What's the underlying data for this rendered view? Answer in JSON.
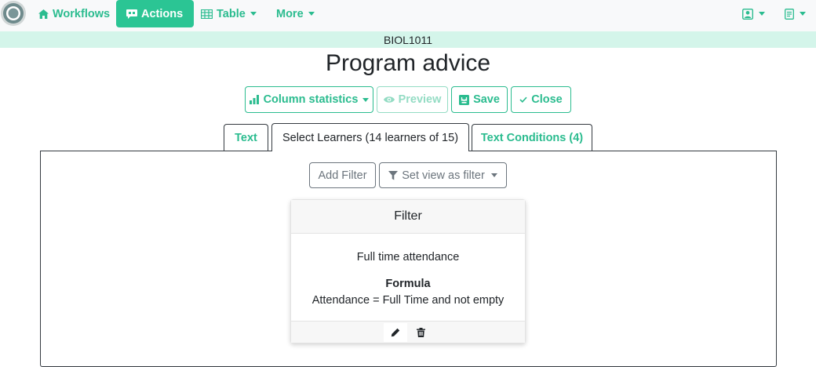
{
  "navbar": {
    "workflows_label": "Workflows",
    "actions_label": "Actions",
    "table_label": "Table",
    "more_label": "More"
  },
  "course_code": "BIOL1011",
  "page_title": "Program advice",
  "toolbar": {
    "column_statistics_label": "Column statistics",
    "preview_label": "Preview",
    "save_label": "Save",
    "close_label": "Close"
  },
  "tabs": [
    {
      "label": "Text"
    },
    {
      "label": "Select Learners (14 learners of 15)"
    },
    {
      "label": "Text Conditions (4)"
    }
  ],
  "filter_toolbar": {
    "add_filter_label": "Add Filter",
    "set_view_label": "Set view as filter"
  },
  "filter_card": {
    "header": "Filter",
    "name": "Full time attendance",
    "formula_label": "Formula",
    "formula": "Attendance = Full Time and not empty"
  },
  "colors": {
    "accent": "#2bbc8f",
    "accent_active_bg": "#2bc594",
    "course_bar_bg": "#d4f5ea",
    "navbar_bg": "#f8f9fa"
  }
}
